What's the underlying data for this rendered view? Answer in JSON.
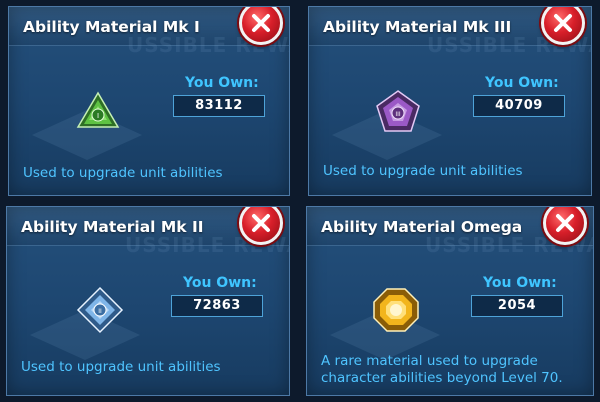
{
  "panels": [
    {
      "title": "Ability Material Mk I",
      "own_label": "You Own:",
      "own_value": "83112",
      "description": "Used to upgrade unit abilities",
      "icon": "ability-mk1-icon",
      "icon_numeral": "I",
      "icon_color": "#5ec243"
    },
    {
      "title": "Ability Material Mk III",
      "own_label": "You Own:",
      "own_value": "40709",
      "description": "Used to upgrade unit abilities",
      "icon": "ability-mk3-icon",
      "icon_numeral": "III",
      "icon_color": "#9b59c6"
    },
    {
      "title": "Ability Material Mk II",
      "own_label": "You Own:",
      "own_value": "72863",
      "description": "Used to upgrade unit abilities",
      "icon": "ability-mk2-icon",
      "icon_numeral": "II",
      "icon_color": "#7fb5e8"
    },
    {
      "title": "Ability Material Omega",
      "own_label": "You Own:",
      "own_value": "2054",
      "description": "A rare material used to upgrade character abilities beyond Level 70.",
      "icon": "ability-omega-icon",
      "icon_numeral": "",
      "icon_color": "#f2b51c"
    }
  ],
  "watermark": "USSIBLE REWARDS",
  "colors": {
    "panel_bg": "#1d4670",
    "accent_text": "#3fc5ff",
    "close_red": "#d81f2a"
  }
}
